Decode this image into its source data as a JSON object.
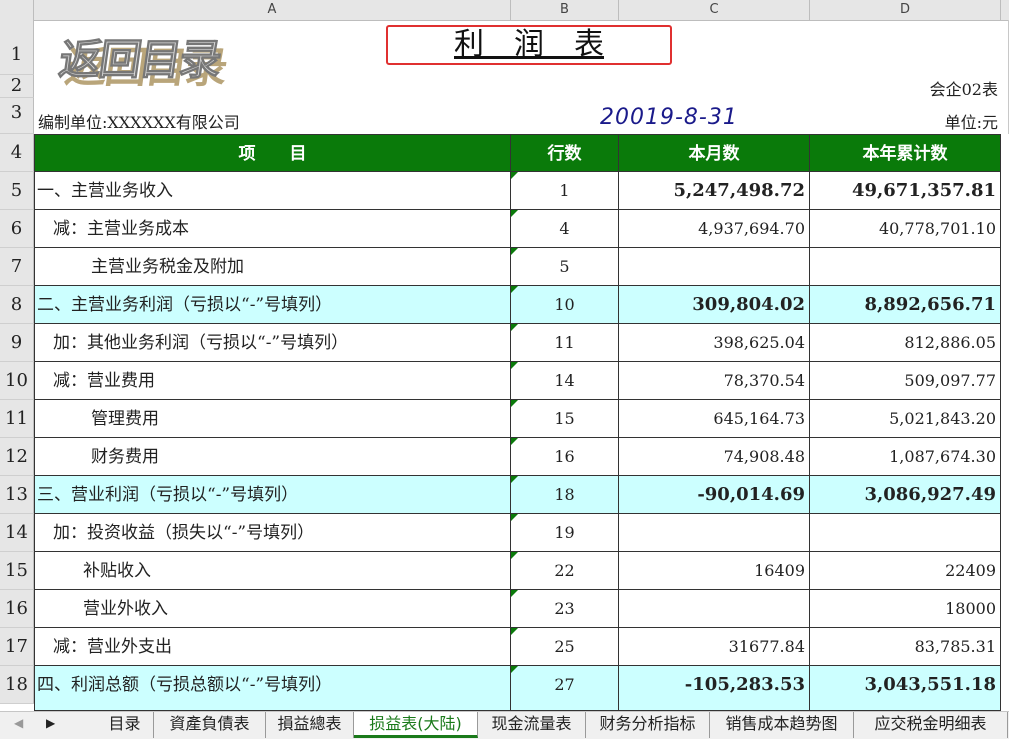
{
  "columns": [
    "A",
    "B",
    "C",
    "D"
  ],
  "rows": [
    "1",
    "2",
    "3",
    "4",
    "5",
    "6",
    "7",
    "8",
    "9",
    "10",
    "11",
    "12",
    "13",
    "14",
    "15",
    "16",
    "17",
    "18"
  ],
  "logo_text": "返回目录",
  "title": "利　润　表",
  "form_code": "会企02表",
  "company": "编制单位:XXXXXX有限公司",
  "date": "20019-8-31",
  "unit": "单位:元",
  "header": {
    "item": "项　　目",
    "line": "行数",
    "month": "本月数",
    "ytd": "本年累计数"
  },
  "table": [
    {
      "item": "一、主营业务收入",
      "line": "1",
      "month": "5,247,498.72",
      "ytd": "49,671,357.81",
      "style": "bold"
    },
    {
      "item": "减：主营业务成本",
      "line": "4",
      "month": "4,937,694.70",
      "ytd": "40,778,701.10",
      "style": "normal"
    },
    {
      "item": "主营业务税金及附加",
      "line": "5",
      "month": "",
      "ytd": "",
      "style": "normal"
    },
    {
      "item": "二、主营业务利润（亏损以“-”号填列）",
      "line": "10",
      "month": "309,804.02",
      "ytd": "8,892,656.71",
      "style": "total"
    },
    {
      "item": "加：其他业务利润（亏损以“-”号填列）",
      "line": "11",
      "month": "398,625.04",
      "ytd": "812,886.05",
      "style": "normal"
    },
    {
      "item": "减：营业费用",
      "line": "14",
      "month": "78,370.54",
      "ytd": "509,097.77",
      "style": "normal"
    },
    {
      "item": "管理费用",
      "line": "15",
      "month": "645,164.73",
      "ytd": "5,021,843.20",
      "style": "normal"
    },
    {
      "item": "财务费用",
      "line": "16",
      "month": "74,908.48",
      "ytd": "1,087,674.30",
      "style": "normal"
    },
    {
      "item": "三、营业利润（亏损以“-”号填列）",
      "line": "18",
      "month": "-90,014.69",
      "ytd": "3,086,927.49",
      "style": "total"
    },
    {
      "item": "加：投资收益（损失以“-”号填列）",
      "line": "19",
      "month": "",
      "ytd": "",
      "style": "normal"
    },
    {
      "item": "补贴收入",
      "line": "22",
      "month": "16409",
      "ytd": "22409",
      "style": "normal"
    },
    {
      "item": "营业外收入",
      "line": "23",
      "month": "",
      "ytd": "18000",
      "style": "normal"
    },
    {
      "item": "减：营业外支出",
      "line": "25",
      "month": "31677.84",
      "ytd": "83,785.31",
      "style": "normal"
    },
    {
      "item": "四、利润总额（亏损总额以“-”号填列）",
      "line": "27",
      "month": "-105,283.53",
      "ytd": "3,043,551.18",
      "style": "total"
    }
  ],
  "tabs": [
    "目录",
    "資產負債表",
    "損益總表",
    "损益表(大陆)",
    "现金流量表",
    "财务分析指标",
    "销售成本趋势图",
    "应交税金明细表"
  ],
  "active_tab": 3,
  "colors": {
    "header_green": "#0a7a0a",
    "total_row": "#ccffff",
    "title_box": "#e03030",
    "date_blue": "#1a1a8a"
  }
}
